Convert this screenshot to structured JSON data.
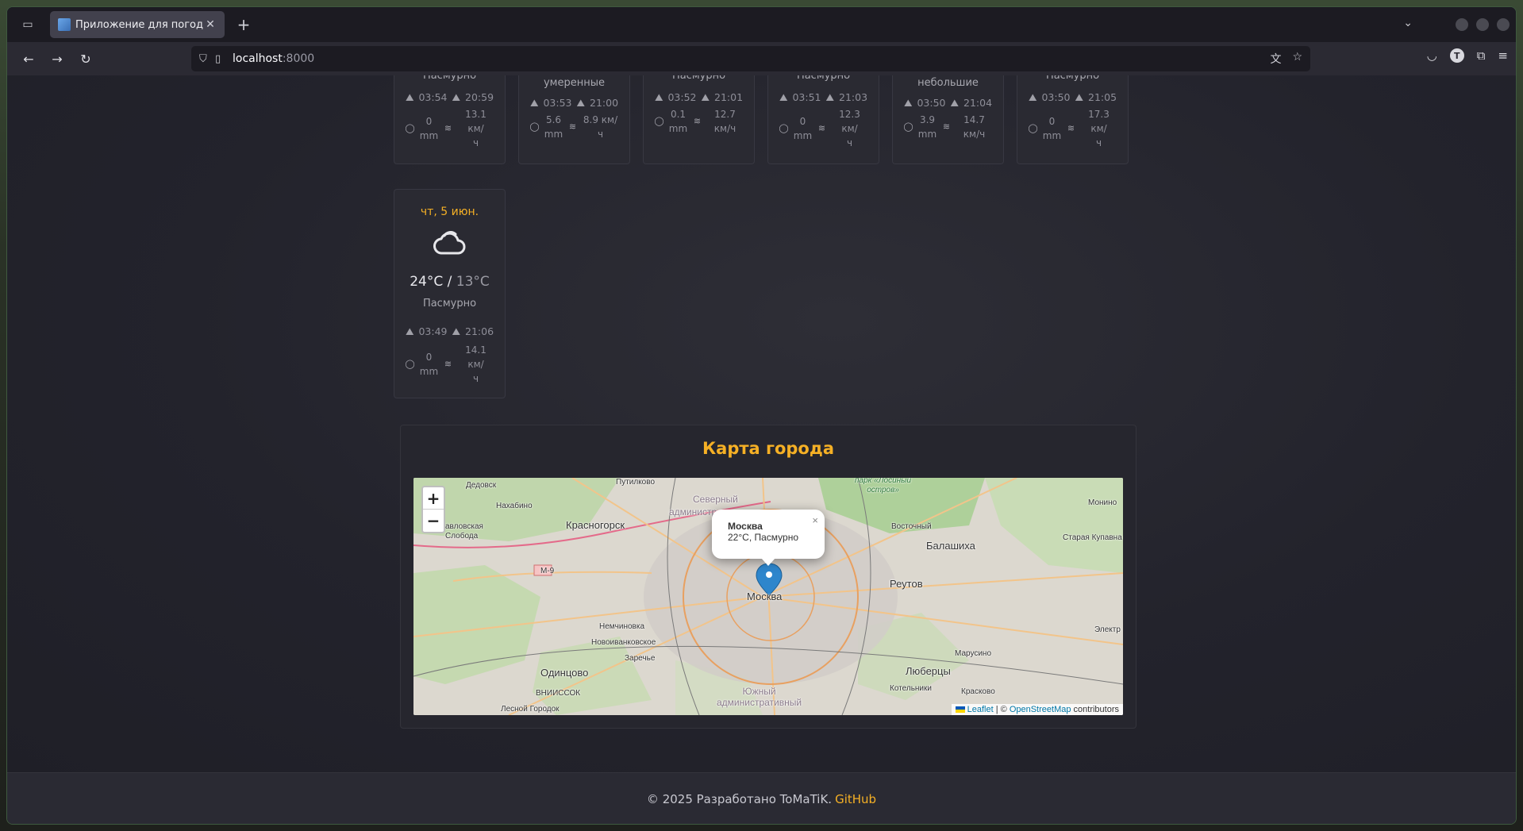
{
  "browser": {
    "tab_title": "Приложение для погоды",
    "url_host": "localhost",
    "url_port": ":8000"
  },
  "top_cards": [
    {
      "desc": "Пасмурно",
      "sunrise": "03:54",
      "sunset": "20:59",
      "precip_num": "0",
      "precip_unit": "mm",
      "wind_num": "13.1 км/",
      "wind_unit": "ч"
    },
    {
      "desc": "Ливни умеренные",
      "sunrise": "03:53",
      "sunset": "21:00",
      "precip_num": "5.6",
      "precip_unit": "mm",
      "wind_num": "8.9 км/",
      "wind_unit": "ч"
    },
    {
      "desc": "Пасмурно",
      "sunrise": "03:52",
      "sunset": "21:01",
      "precip_num": "0.1",
      "precip_unit": "mm",
      "wind_num": "12.7",
      "wind_unit": "км/ч"
    },
    {
      "desc": "Пасмурно",
      "sunrise": "03:51",
      "sunset": "21:03",
      "precip_num": "0",
      "precip_unit": "mm",
      "wind_num": "12.3 км/",
      "wind_unit": "ч"
    },
    {
      "desc": "Ливни небольшие",
      "sunrise": "03:50",
      "sunset": "21:04",
      "precip_num": "3.9",
      "precip_unit": "mm",
      "wind_num": "14.7",
      "wind_unit": "км/ч"
    },
    {
      "desc": "Пасмурно",
      "sunrise": "03:50",
      "sunset": "21:05",
      "precip_num": "0",
      "precip_unit": "mm",
      "wind_num": "17.3 км/",
      "wind_unit": "ч"
    }
  ],
  "day_card": {
    "date": "чт, 5 июн.",
    "icon": "cloud-icon",
    "temp_high": "24°C",
    "sep": " / ",
    "temp_low": "13°C",
    "desc": "Пасмурно",
    "sunrise": "03:49",
    "sunset": "21:06",
    "precip_num": "0",
    "precip_unit": "mm",
    "wind_num": "14.1 км/",
    "wind_unit": "ч"
  },
  "map": {
    "title": "Карта города",
    "zoom_in": "+",
    "zoom_out": "−",
    "popup_name": "Москва",
    "popup_text": "22°C, Пасмурно",
    "popup_close": "×",
    "labels": {
      "moskva": "Москва",
      "krasnogorsk": "Красногорск",
      "balashikha": "Балашиха",
      "reutov": "Реутов",
      "odintsovo": "Одинцово",
      "lyubertsy": "Люберцы",
      "dedovsk": "Дедовск",
      "nakhabino": "Нахабино",
      "putilkovo": "Путилково",
      "pavlovskaya_sloboda": "авловская\nСлобода",
      "severny": "Северный",
      "administr": "администр",
      "losiny": "парк «Лосиный\nостров»",
      "vostochny": "Восточный",
      "monino": "Монино",
      "staraya_kupavna": "Старая Купавна",
      "nemchinovka": "Немчиновка",
      "novoivankovskoe": "Новоиванковское",
      "zarechye": "Заречье",
      "vniissok": "ВНИИССОК",
      "lesnoy_gorodok": "Лесной Городок",
      "yuzhny": "Южный\nадминистративный",
      "marusino": "Марусино",
      "kotelniki": "Котельники",
      "kraskovo": "Красково",
      "elektro": "Электр",
      "m9": "М-9"
    },
    "attribution_leaflet": "Leaflet",
    "attribution_sep": " | © ",
    "attribution_osm": "OpenStreetMap",
    "attribution_contrib": " contributors"
  },
  "footer": {
    "text": "© 2025 Разработано ToMaTiK.",
    "link": "GitHub"
  }
}
